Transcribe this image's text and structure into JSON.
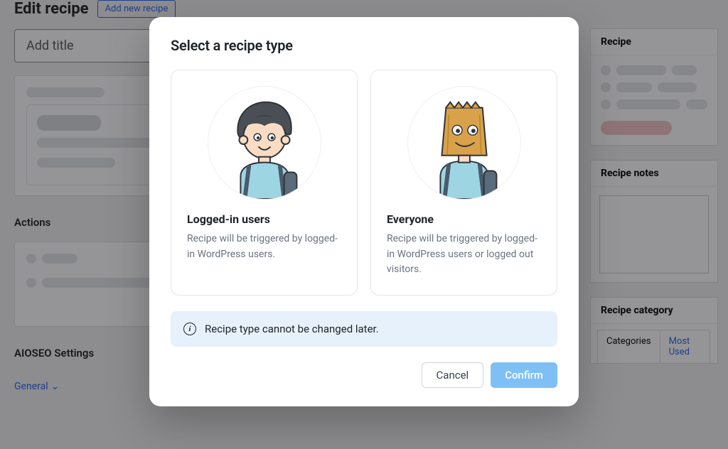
{
  "bg": {
    "edit_title": "Edit recipe",
    "add_new": "Add new recipe",
    "title_placeholder": "Add title",
    "actions": "Actions",
    "aioseo": "AIOSEO Settings",
    "general": "General",
    "side": {
      "recipe": "Recipe",
      "notes": "Recipe notes",
      "category": "Recipe category",
      "tab_categories": "Categories",
      "tab_most_used": "Most Used"
    }
  },
  "modal": {
    "title": "Select a recipe type",
    "options": [
      {
        "id": "logged-in",
        "title": "Logged-in users",
        "desc": "Recipe will be triggered by logged-in WordPress users."
      },
      {
        "id": "everyone",
        "title": "Everyone",
        "desc": "Recipe will be triggered by logged-in WordPress users or logged out visitors."
      }
    ],
    "info": "Recipe type cannot be changed later.",
    "cancel": "Cancel",
    "confirm": "Confirm"
  }
}
